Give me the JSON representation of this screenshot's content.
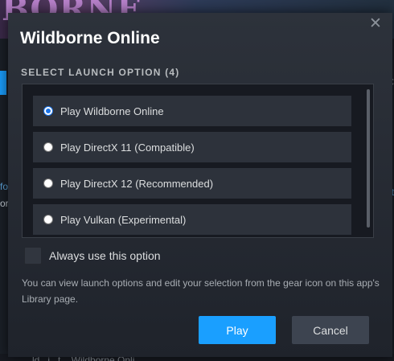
{
  "background": {
    "logo_text": "BORNE",
    "left_link": "fo",
    "left_text": "or",
    "right_text": "AC",
    "right_link": "ot",
    "footer_text": "...ld...i...t... Wildborne Onli..."
  },
  "dialog": {
    "title": "Wildborne Online",
    "close_label": "✕",
    "section_label": "SELECT LAUNCH OPTION (4)",
    "options": [
      {
        "label": "Play Wildborne Online",
        "checked": true
      },
      {
        "label": "Play DirectX 11 (Compatible)",
        "checked": false
      },
      {
        "label": "Play DirectX 12 (Recommended)",
        "checked": false
      },
      {
        "label": "Play Vulkan (Experimental)",
        "checked": false
      }
    ],
    "always_use_label": "Always use this option",
    "help_text": "You can view launch options and edit your selection from the gear icon on this app's Library page.",
    "play_label": "Play",
    "cancel_label": "Cancel"
  },
  "colors": {
    "accent": "#1a9fff",
    "dialog_bg": "#2d323b",
    "list_bg": "#171a21",
    "option_bg": "#2d323b"
  }
}
